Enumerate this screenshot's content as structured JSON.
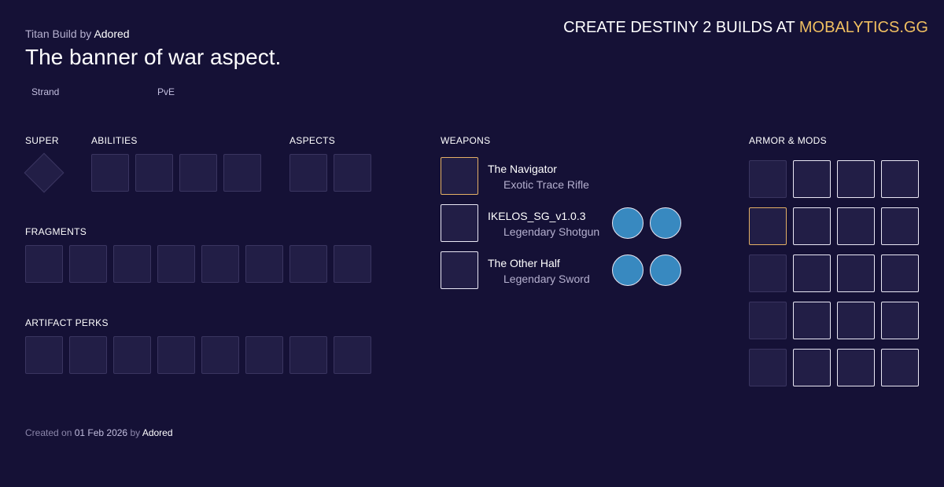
{
  "header": {
    "subtitle_prefix": "Titan Build by",
    "author": "Adored",
    "title": "The banner of war aspect.",
    "promo_prefix": "CREATE DESTINY 2 BUILDS AT",
    "promo_brand": "MOBALYTICS.GG"
  },
  "tags": {
    "subclass": "Strand",
    "mode": "PvE"
  },
  "sections": {
    "super": "SUPER",
    "abilities": "ABILITIES",
    "aspects": "ASPECTS",
    "fragments": "FRAGMENTS",
    "artifact_perks": "ARTIFACT PERKS",
    "weapons": "WEAPONS",
    "armor_mods": "ARMOR & MODS"
  },
  "weapons": [
    {
      "name": "The Navigator",
      "type": "Exotic Trace Rifle",
      "rarity": "exotic",
      "perk_count": 0
    },
    {
      "name": "IKELOS_SG_v1.0.3",
      "type": "Legendary Shotgun",
      "rarity": "legendary",
      "perk_count": 2
    },
    {
      "name": "The Other Half",
      "type": "Legendary Sword",
      "rarity": "legendary",
      "perk_count": 2
    }
  ],
  "counts": {
    "abilities": 4,
    "aspects": 2,
    "fragments": 8,
    "artifact_perks": 8,
    "armor_rows": 5,
    "mods_per_row": 3
  },
  "footer": {
    "created_on": "Created on",
    "date": "01 Feb 2026",
    "by": "by",
    "author": "Adored"
  },
  "colors": {
    "background": "#151136",
    "exotic_border": "#e4b065",
    "brand_accent": "#f0bf61",
    "perk_fill": "#3889c0"
  }
}
